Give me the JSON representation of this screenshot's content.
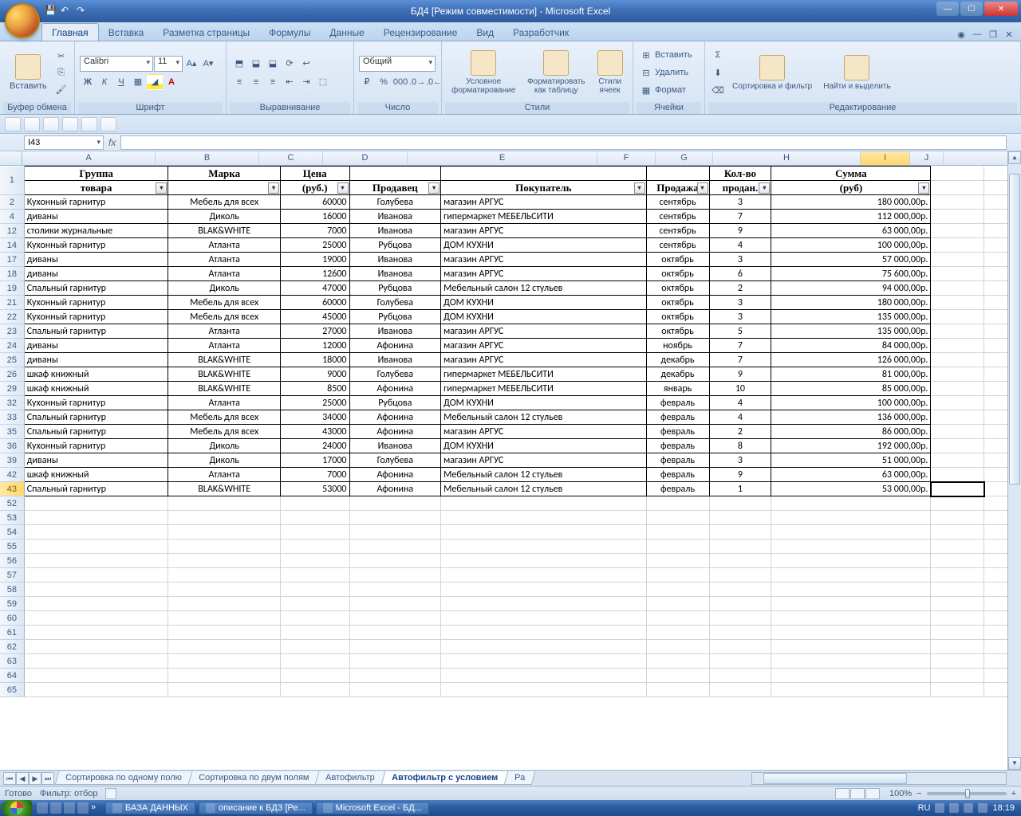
{
  "title": "БД4  [Режим совместимости] - Microsoft Excel",
  "ribbon_tabs": [
    "Главная",
    "Вставка",
    "Разметка страницы",
    "Формулы",
    "Данные",
    "Рецензирование",
    "Вид",
    "Разработчик"
  ],
  "active_ribbon_tab": 0,
  "ribbon_groups": {
    "clipboard": {
      "label": "Буфер обмена",
      "paste": "Вставить"
    },
    "font": {
      "label": "Шрифт",
      "name": "Calibri",
      "size": "11"
    },
    "align": {
      "label": "Выравнивание"
    },
    "number": {
      "label": "Число",
      "format": "Общий"
    },
    "styles": {
      "label": "Стили",
      "cond": "Условное форматирование",
      "table": "Форматировать как таблицу",
      "cell": "Стили ячеек"
    },
    "cells": {
      "label": "Ячейки",
      "insert": "Вставить",
      "delete": "Удалить",
      "format": "Формат"
    },
    "editing": {
      "label": "Редактирование",
      "sort": "Сортировка и фильтр",
      "find": "Найти и выделить"
    }
  },
  "namebox": "I43",
  "columns": [
    "A",
    "B",
    "C",
    "D",
    "E",
    "F",
    "G",
    "H",
    "I",
    "J"
  ],
  "selected_col": "I",
  "headers_line1": {
    "A": "Группа",
    "B": "Марка",
    "C": "Цена",
    "D": "",
    "E": "",
    "F": "",
    "G": "Кол-во",
    "H": "Сумма"
  },
  "headers_line2": {
    "A": "товара",
    "B": "",
    "C": "(руб.)",
    "D": "Продавец",
    "E": "Покупатель",
    "F": "Продажа",
    "G": "продан.",
    "H": "(руб)"
  },
  "row_numbers": [
    1,
    2,
    4,
    12,
    14,
    17,
    18,
    19,
    21,
    22,
    23,
    24,
    25,
    26,
    29,
    32,
    33,
    35,
    36,
    39,
    42,
    43
  ],
  "selected_row": 43,
  "data_rows": [
    {
      "n": 2,
      "A": "Кухонный гарнитур",
      "B": "Мебель для всех",
      "C": "60000",
      "D": "Голубева",
      "E": "магазин АРГУС",
      "F": "сентябрь",
      "G": "3",
      "H": "180 000,00р."
    },
    {
      "n": 4,
      "A": "диваны",
      "B": "Диколь",
      "C": "16000",
      "D": "Иванова",
      "E": "гипермаркет МЕБЕЛЬСИТИ",
      "F": "сентябрь",
      "G": "7",
      "H": "112 000,00р."
    },
    {
      "n": 12,
      "A": "столики журнальные",
      "B": "BLAK&WHITE",
      "C": "7000",
      "D": "Иванова",
      "E": "магазин АРГУС",
      "F": "сентябрь",
      "G": "9",
      "H": "63 000,00р."
    },
    {
      "n": 14,
      "A": "Кухонный гарнитур",
      "B": "Атланта",
      "C": "25000",
      "D": "Рубцова",
      "E": "ДОМ КУХНИ",
      "F": "сентябрь",
      "G": "4",
      "H": "100 000,00р."
    },
    {
      "n": 17,
      "A": "диваны",
      "B": "Атланта",
      "C": "19000",
      "D": "Иванова",
      "E": "магазин АРГУС",
      "F": "октябрь",
      "G": "3",
      "H": "57 000,00р."
    },
    {
      "n": 18,
      "A": "диваны",
      "B": "Атланта",
      "C": "12600",
      "D": "Иванова",
      "E": "магазин АРГУС",
      "F": "октябрь",
      "G": "6",
      "H": "75 600,00р."
    },
    {
      "n": 19,
      "A": "Спальный гарнитур",
      "B": "Диколь",
      "C": "47000",
      "D": "Рубцова",
      "E": "Мебельный салон 12 стульев",
      "F": "октябрь",
      "G": "2",
      "H": "94 000,00р."
    },
    {
      "n": 21,
      "A": "Кухонный гарнитур",
      "B": "Мебель для всех",
      "C": "60000",
      "D": "Голубева",
      "E": "ДОМ КУХНИ",
      "F": "октябрь",
      "G": "3",
      "H": "180 000,00р."
    },
    {
      "n": 22,
      "A": "Кухонный гарнитур",
      "B": "Мебель для всех",
      "C": "45000",
      "D": "Рубцова",
      "E": "ДОМ КУХНИ",
      "F": "октябрь",
      "G": "3",
      "H": "135 000,00р."
    },
    {
      "n": 23,
      "A": "Спальный гарнитур",
      "B": "Атланта",
      "C": "27000",
      "D": "Иванова",
      "E": "магазин АРГУС",
      "F": "октябрь",
      "G": "5",
      "H": "135 000,00р."
    },
    {
      "n": 24,
      "A": "диваны",
      "B": "Атланта",
      "C": "12000",
      "D": "Афонина",
      "E": "магазин АРГУС",
      "F": "ноябрь",
      "G": "7",
      "H": "84 000,00р."
    },
    {
      "n": 25,
      "A": "диваны",
      "B": "BLAK&WHITE",
      "C": "18000",
      "D": "Иванова",
      "E": "магазин АРГУС",
      "F": "декабрь",
      "G": "7",
      "H": "126 000,00р."
    },
    {
      "n": 26,
      "A": "шкаф книжный",
      "B": "BLAK&WHITE",
      "C": "9000",
      "D": "Голубева",
      "E": "гипермаркет МЕБЕЛЬСИТИ",
      "F": "декабрь",
      "G": "9",
      "H": "81 000,00р."
    },
    {
      "n": 29,
      "A": "шкаф книжный",
      "B": "BLAK&WHITE",
      "C": "8500",
      "D": "Афонина",
      "E": "гипермаркет МЕБЕЛЬСИТИ",
      "F": "январь",
      "G": "10",
      "H": "85 000,00р."
    },
    {
      "n": 32,
      "A": "Кухонный гарнитур",
      "B": "Атланта",
      "C": "25000",
      "D": "Рубцова",
      "E": "ДОМ КУХНИ",
      "F": "февраль",
      "G": "4",
      "H": "100 000,00р."
    },
    {
      "n": 33,
      "A": "Спальный гарнитур",
      "B": "Мебель для всех",
      "C": "34000",
      "D": "Афонина",
      "E": "Мебельный салон 12 стульев",
      "F": "февраль",
      "G": "4",
      "H": "136 000,00р."
    },
    {
      "n": 35,
      "A": "Спальный гарнитур",
      "B": "Мебель для всех",
      "C": "43000",
      "D": "Афонина",
      "E": "магазин АРГУС",
      "F": "февраль",
      "G": "2",
      "H": "86 000,00р."
    },
    {
      "n": 36,
      "A": "Кухонный гарнитур",
      "B": "Диколь",
      "C": "24000",
      "D": "Иванова",
      "E": "ДОМ КУХНИ",
      "F": "февраль",
      "G": "8",
      "H": "192 000,00р."
    },
    {
      "n": 39,
      "A": "диваны",
      "B": "Диколь",
      "C": "17000",
      "D": "Голубева",
      "E": "магазин АРГУС",
      "F": "февраль",
      "G": "3",
      "H": "51 000,00р."
    },
    {
      "n": 42,
      "A": "шкаф книжный",
      "B": "Атланта",
      "C": "7000",
      "D": "Афонина",
      "E": "Мебельный салон 12 стульев",
      "F": "февраль",
      "G": "9",
      "H": "63 000,00р."
    },
    {
      "n": 43,
      "A": "Спальный гарнитур",
      "B": "BLAK&WHITE",
      "C": "53000",
      "D": "Афонина",
      "E": "Мебельный салон 12 стульев",
      "F": "февраль",
      "G": "1",
      "H": "53 000,00р."
    }
  ],
  "empty_rows": [
    52,
    53,
    54,
    55,
    56,
    57,
    58,
    59,
    60,
    61,
    62,
    63,
    64,
    65
  ],
  "sheet_tabs": [
    "Сортировка по одному полю",
    "Сортировка по двум полям",
    "Автофильтр",
    "Автофильтр с условием",
    "Ра"
  ],
  "active_sheet_tab": 3,
  "status": {
    "ready": "Готово",
    "filter": "Фильтр: отбор",
    "zoom": "100%"
  },
  "taskbar": {
    "items": [
      "БАЗА ДАННЫХ",
      "описание к БДЗ [Ре...",
      "Microsoft Excel - БД..."
    ],
    "lang": "RU",
    "time": "18:19"
  }
}
